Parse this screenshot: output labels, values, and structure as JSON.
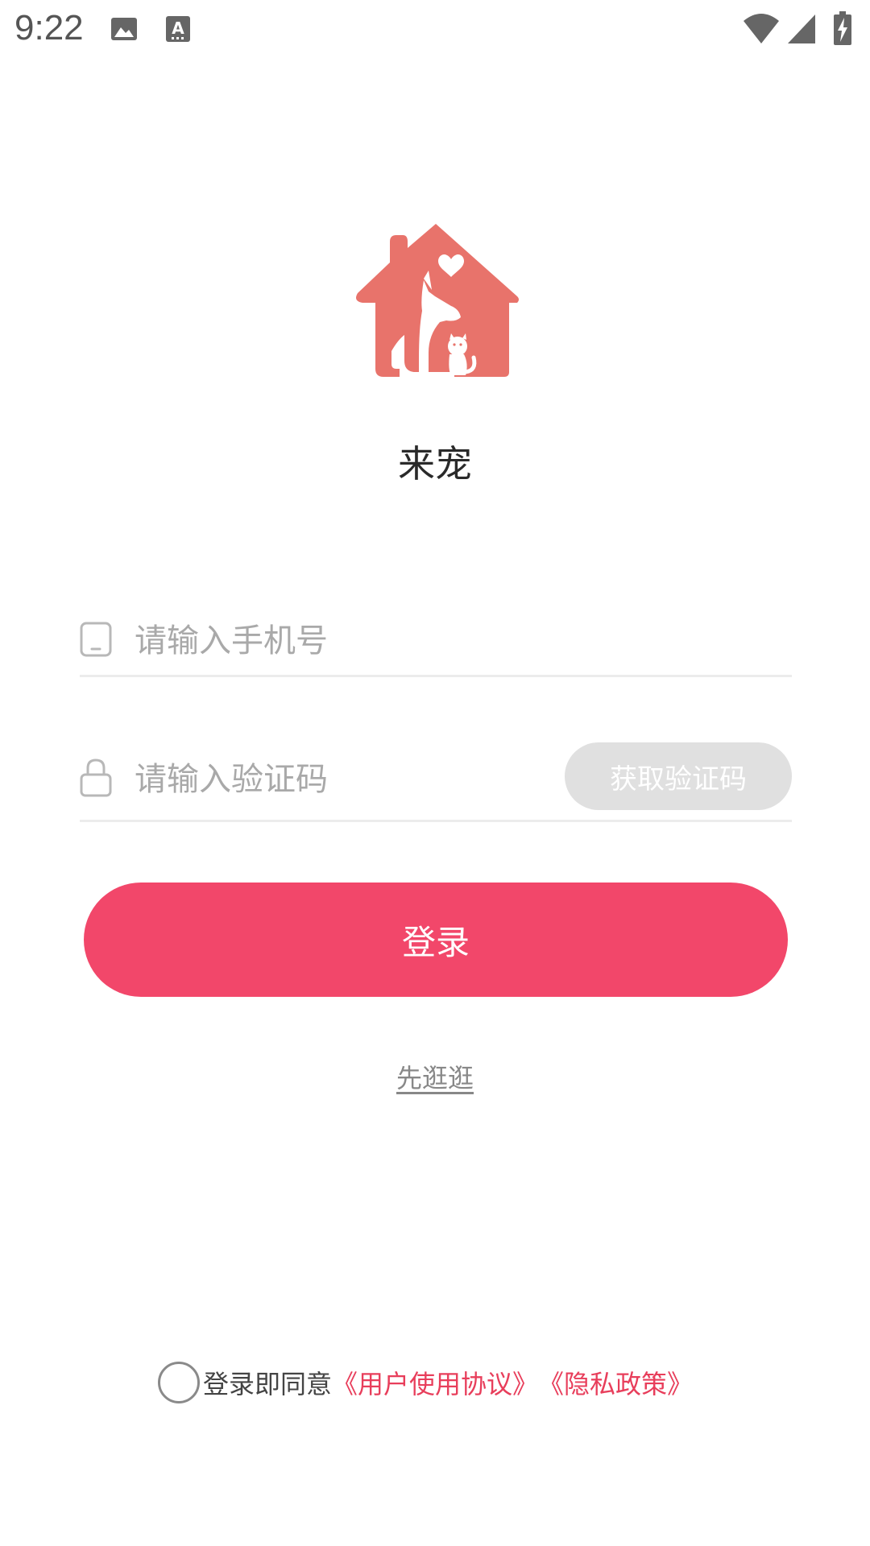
{
  "status_bar": {
    "time": "9:22",
    "left_icons": [
      "image-icon",
      "text-a-icon"
    ],
    "right_icons": [
      "wifi-icon",
      "cellular-signal-icon",
      "battery-charging-icon"
    ]
  },
  "app": {
    "name": "来宠",
    "logo_icon": "pet-house-logo-icon"
  },
  "form": {
    "phone": {
      "icon": "phone-icon",
      "placeholder": "请输入手机号",
      "value": ""
    },
    "code": {
      "icon": "lock-icon",
      "placeholder": "请输入验证码",
      "value": "",
      "get_code_label": "获取验证码"
    },
    "login_label": "登录",
    "browse_label": "先逛逛"
  },
  "agreement": {
    "checked": false,
    "prefix": "登录即同意",
    "user_agreement": "《用户使用协议》",
    "privacy_policy": "《隐私政策》"
  },
  "colors": {
    "primary": "#f2476a",
    "logo": "#e8736b",
    "link": "#e83e5b",
    "disabled_button": "#e0e0e0"
  }
}
